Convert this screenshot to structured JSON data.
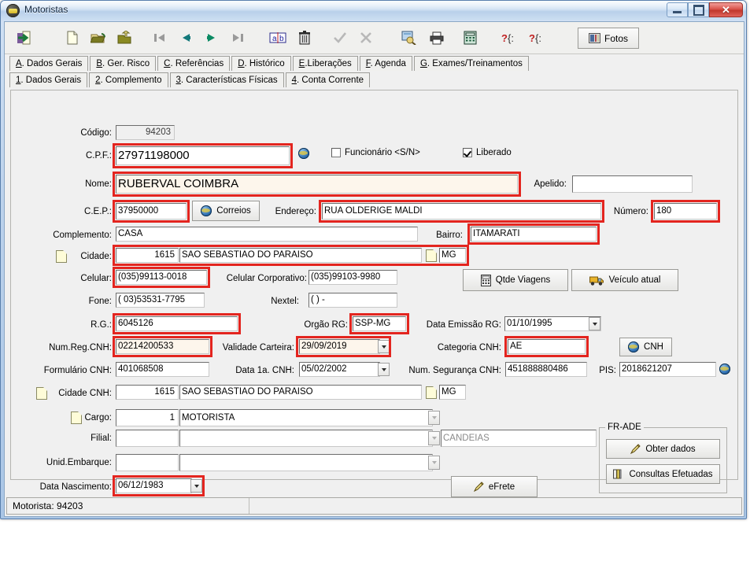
{
  "window": {
    "title": "Motoristas",
    "app_icon": "user-car-icon",
    "minimize_label": "Minimizar",
    "maximize_label": "Maximizar",
    "close_label": "Fechar"
  },
  "toolbar": {
    "buttons": [
      {
        "name": "exit-icon",
        "title": "Sair"
      },
      {
        "name": "new-document-icon",
        "title": "Novo"
      },
      {
        "name": "open-folder-icon",
        "title": "Abrir"
      },
      {
        "name": "save-folder-icon",
        "title": "Salvar"
      },
      {
        "name": "first-record-icon",
        "title": "Primeiro"
      },
      {
        "name": "previous-record-icon",
        "title": "Anterior"
      },
      {
        "name": "next-record-icon",
        "title": "Próximo"
      },
      {
        "name": "last-record-icon",
        "title": "Último"
      },
      {
        "name": "edit-ab-icon",
        "title": "Editar"
      },
      {
        "name": "delete-trash-icon",
        "title": "Excluir"
      },
      {
        "name": "confirm-check-icon",
        "title": "Confirmar"
      },
      {
        "name": "cancel-x-icon",
        "title": "Cancelar"
      },
      {
        "name": "search-preview-icon",
        "title": "Consultar"
      },
      {
        "name": "print-icon",
        "title": "Imprimir"
      },
      {
        "name": "calculator-icon",
        "title": "Calculadora"
      },
      {
        "name": "help-query-icon",
        "title": "Ajuda"
      },
      {
        "name": "help-query2-icon",
        "title": "Ajuda 2"
      }
    ],
    "fotos_label": "Fotos",
    "fotos_icon": "photos-icon"
  },
  "tabs_main": [
    {
      "accel": "A",
      "label": ". Dados Gerais",
      "active": true
    },
    {
      "accel": "B",
      "label": ". Ger. Risco",
      "active": false
    },
    {
      "accel": "C",
      "label": ". Referências",
      "active": false
    },
    {
      "accel": "D",
      "label": ". Histórico",
      "active": false
    },
    {
      "accel": "E",
      "label": ".Liberações",
      "active": false
    },
    {
      "accel": "F",
      "label": ". Agenda",
      "active": false
    },
    {
      "accel": "G",
      "label": ". Exames/Treinamentos",
      "active": false
    }
  ],
  "tabs_sub": [
    {
      "accel": "1",
      "label": ". Dados Gerais",
      "active": true
    },
    {
      "accel": "2",
      "label": ". Complemento",
      "active": false
    },
    {
      "accel": "3",
      "label": ". Características Físicas",
      "active": false
    },
    {
      "accel": "4",
      "label": ". Conta Corrente",
      "active": false
    }
  ],
  "form": {
    "codigo": {
      "label": "Código:",
      "value": "94203"
    },
    "cpf": {
      "label": "C.P.F.:",
      "value": "27971198000",
      "globe_icon": "globe-icon"
    },
    "funcionario": {
      "label": "Funcionário <S/N>",
      "checked": false
    },
    "liberado": {
      "label": "Liberado",
      "checked": true
    },
    "nome": {
      "label": "Nome:",
      "value": "RUBERVAL COIMBRA"
    },
    "apelido": {
      "label": "Apelido:",
      "value": ""
    },
    "cep": {
      "label": "C.E.P.:",
      "value": "37950000"
    },
    "correios": {
      "label": "Correios",
      "icon": "globe-icon"
    },
    "endereco": {
      "label": "Endereço:",
      "value": "RUA OLDERIGE MALDI"
    },
    "numero": {
      "label": "Número:",
      "value": "180"
    },
    "complemento": {
      "label": "Complemento:",
      "value": "CASA"
    },
    "bairro": {
      "label": "Bairro:",
      "value": "ITAMARATI"
    },
    "cidade": {
      "label": "Cidade:",
      "code": "1615",
      "value": "SAO SEBASTIAO DO PARAISO",
      "uf": "MG",
      "doc_icon": "document-icon"
    },
    "celular": {
      "label": "Celular:",
      "value": "(035)99113-0018"
    },
    "celular_corp": {
      "label": "Celular Corporativo:",
      "value": "(035)99103-9980"
    },
    "fone": {
      "label": "Fone:",
      "value": "( 03)53531-7795"
    },
    "nextel": {
      "label": "Nextel:",
      "value": "(  )     -"
    },
    "rg": {
      "label": "R.G.:",
      "value": "6045126"
    },
    "orgao_rg": {
      "label": "Orgão RG:",
      "value": "SSP-MG"
    },
    "data_emissao_rg": {
      "label": "Data Emissão RG:",
      "value": "01/10/1995"
    },
    "num_reg_cnh": {
      "label": "Num.Reg.CNH:",
      "value": "02214200533"
    },
    "validade_carteira": {
      "label": "Validade Carteira:",
      "value": "29/09/2019"
    },
    "categoria_cnh": {
      "label": "Categoria CNH:",
      "value": "AE"
    },
    "cnh_button": {
      "label": "CNH",
      "icon": "globe-icon"
    },
    "formulario_cnh": {
      "label": "Formulário CNH:",
      "value": "401068508"
    },
    "data_1a_cnh": {
      "label": "Data 1a. CNH:",
      "value": "05/02/2002"
    },
    "num_seguranca_cnh": {
      "label": "Num. Segurança CNH:",
      "value": "451888880486"
    },
    "pis": {
      "label": "PIS:",
      "value": "2018621207",
      "globe_icon": "globe-icon"
    },
    "cidade_cnh": {
      "label": "Cidade CNH:",
      "code": "1615",
      "value": "SAO SEBASTIAO DO PARAISO",
      "uf": "MG",
      "doc_icon": "document-icon"
    },
    "cargo": {
      "label": "Cargo:",
      "code": "1",
      "value": "MOTORISTA",
      "doc_icon": "document-icon"
    },
    "filial": {
      "label": "Filial:",
      "code": "",
      "value": "",
      "extra": "CANDEIAS"
    },
    "unid_embarque": {
      "label": "Unid.Embarque:",
      "code": "",
      "value": ""
    },
    "data_nascimento": {
      "label": "Data Nascimento:",
      "value": "06/12/1983"
    }
  },
  "buttons": {
    "qtde_viagens": {
      "label": "Qtde Viagens",
      "icon": "calculator-icon"
    },
    "veiculo_atual": {
      "label": "Veículo atual",
      "icon": "truck-icon"
    },
    "efrete": {
      "label": "eFrete",
      "icon": "pen-icon"
    },
    "obter_dados": {
      "label": "Obter dados",
      "icon": "pen-icon"
    },
    "consultas_efetuadas": {
      "label": "Consultas Efetuadas",
      "icon": "book-icon"
    }
  },
  "groups": {
    "fr_ade": {
      "title": "FR-ADE"
    }
  },
  "statusbar": {
    "left": "Motorista: 94203",
    "right": ""
  },
  "colors": {
    "highlight_red": "#e3251f",
    "titlebar_blue": "#bcd2ec",
    "panel_gray": "#f0f0f0",
    "field_white": "#ffffff",
    "field_cream": "#fdf6ec"
  }
}
